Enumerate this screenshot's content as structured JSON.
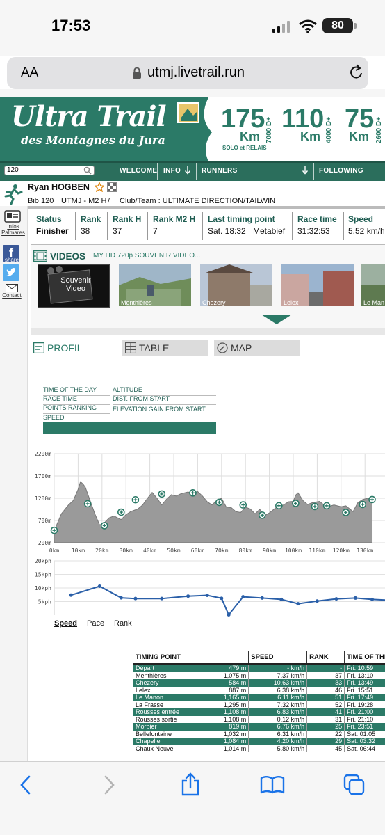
{
  "status_bar": {
    "time": "17:53",
    "battery": "80"
  },
  "browser": {
    "text_size": "AA",
    "url": "utmj.livetrail.run"
  },
  "banner": {
    "title": "Ultra Trail",
    "subtitle": "des Montagnes du Jura",
    "races": [
      {
        "km": "175",
        "unit": "Km",
        "elev": "7000 D+",
        "note": "SOLO et RELAIS"
      },
      {
        "km": "110",
        "unit": "Km",
        "elev": "4000 D+"
      },
      {
        "km": "75",
        "unit": "Km",
        "elev": "2600 D+"
      }
    ]
  },
  "nav": {
    "search_value": "120",
    "welcome": "WELCOME",
    "info": "INFO",
    "runners": "RUNNERS",
    "following": "FOLLOWING"
  },
  "runner": {
    "name": "Ryan HOGBEN",
    "bib": "Bib 120",
    "category": "UTMJ - M2 H",
    "sep": "/",
    "club": "Club/Team : ULTIMATE DIRECTION/TAILWIN"
  },
  "sidebar": {
    "infos": "Infos Palmares",
    "share": "share",
    "contact": "Contact"
  },
  "stats": {
    "headers": [
      "Status",
      "Rank",
      "Rank H",
      "Rank M2 H",
      "Last timing point",
      "Race time",
      "Speed"
    ],
    "values": [
      "Finisher",
      "38",
      "37",
      "7",
      "Sat. 18:32",
      "31:32:53",
      "5.52 km/h"
    ],
    "last_point_place": "Metabief"
  },
  "videos": {
    "title": "VIDEOS",
    "subtitle": "MY HD 720p SOUVENIR VIDEO...",
    "souvenir": "Souvenir Video",
    "items": [
      "Menthières",
      "Chezery",
      "Lelex",
      "Le Man"
    ]
  },
  "tabs": {
    "profil": "PROFIL",
    "table": "TABLE",
    "map": "MAP"
  },
  "legend": {
    "left": [
      "TIME OF THE DAY",
      "RACE TIME",
      "POINTS RANKING",
      "SPEED"
    ],
    "right": [
      "ALTITUDE",
      "DIST. FROM START",
      "ELEVATION GAIN FROM START"
    ]
  },
  "chart_data": [
    {
      "type": "area",
      "title": "",
      "ylim": [
        200,
        2200
      ],
      "y_ticks": [
        "2200m",
        "1700m",
        "1200m",
        "700m",
        "200m"
      ],
      "x_ticks": [
        "0km",
        "10km",
        "20km",
        "30km",
        "40km",
        "50km",
        "60km",
        "70km",
        "80km",
        "90km",
        "100km",
        "110km",
        "120km",
        "130km"
      ],
      "xlim": [
        0,
        133
      ],
      "profile": [
        [
          0,
          470
        ],
        [
          3,
          850
        ],
        [
          6,
          1050
        ],
        [
          8,
          1150
        ],
        [
          10,
          1400
        ],
        [
          11,
          1570
        ],
        [
          12,
          1520
        ],
        [
          13,
          1450
        ],
        [
          15,
          1150
        ],
        [
          17,
          850
        ],
        [
          19,
          600
        ],
        [
          21,
          650
        ],
        [
          23,
          760
        ],
        [
          25,
          800
        ],
        [
          28,
          720
        ],
        [
          30,
          830
        ],
        [
          32,
          900
        ],
        [
          35,
          960
        ],
        [
          37,
          1050
        ],
        [
          39,
          1200
        ],
        [
          41,
          1330
        ],
        [
          43,
          1200
        ],
        [
          45,
          1050
        ],
        [
          47,
          1180
        ],
        [
          49,
          1280
        ],
        [
          51,
          1250
        ],
        [
          53,
          1300
        ],
        [
          56,
          1340
        ],
        [
          58,
          1300
        ],
        [
          60,
          1350
        ],
        [
          62,
          1250
        ],
        [
          64,
          1120
        ],
        [
          66,
          1050
        ],
        [
          68,
          1150
        ],
        [
          70,
          1200
        ],
        [
          72,
          1000
        ],
        [
          74,
          990
        ],
        [
          76,
          900
        ],
        [
          78,
          880
        ],
        [
          80,
          1000
        ],
        [
          82,
          960
        ],
        [
          84,
          850
        ],
        [
          86,
          950
        ],
        [
          88,
          810
        ],
        [
          90,
          870
        ],
        [
          93,
          1000
        ],
        [
          96,
          1050
        ],
        [
          98,
          1120
        ],
        [
          100,
          1130
        ],
        [
          101,
          1270
        ],
        [
          102,
          1320
        ],
        [
          104,
          1150
        ],
        [
          106,
          1060
        ],
        [
          108,
          1100
        ],
        [
          111,
          1130
        ],
        [
          114,
          1000
        ],
        [
          117,
          1050
        ],
        [
          120,
          1010
        ],
        [
          122,
          1030
        ],
        [
          125,
          900
        ],
        [
          127,
          1100
        ],
        [
          129,
          1170
        ],
        [
          131,
          1200
        ],
        [
          133,
          1220
        ]
      ],
      "points": [
        [
          0,
          479
        ],
        [
          14,
          1075
        ],
        [
          21,
          584
        ],
        [
          28,
          887
        ],
        [
          34,
          1165
        ],
        [
          45,
          1295
        ],
        [
          58,
          1320
        ],
        [
          69,
          1108
        ],
        [
          79,
          1050
        ],
        [
          87,
          819
        ],
        [
          94,
          1032
        ],
        [
          101,
          1084
        ],
        [
          109,
          1014
        ],
        [
          114,
          1030
        ],
        [
          122,
          880
        ],
        [
          129,
          1060
        ],
        [
          133,
          1170
        ]
      ]
    },
    {
      "type": "line",
      "title": "",
      "ylim": [
        0,
        20
      ],
      "y_ticks": [
        "20kph",
        "15kph",
        "10kph",
        "5kph"
      ],
      "series": [
        {
          "values": [
            [
              7,
              7.37
            ],
            [
              19,
              10.63
            ],
            [
              28,
              6.38
            ],
            [
              34,
              6.11
            ],
            [
              45,
              6.11
            ],
            [
              56,
              7.0
            ],
            [
              64,
              7.3
            ],
            [
              70,
              6.2
            ],
            [
              73,
              0.12
            ],
            [
              79,
              6.76
            ],
            [
              87,
              6.31
            ],
            [
              95,
              5.8
            ],
            [
              102,
              4.2
            ],
            [
              110,
              5.2
            ],
            [
              118,
              6.0
            ],
            [
              126,
              6.3
            ],
            [
              133,
              5.8
            ],
            [
              140,
              5.52
            ]
          ]
        }
      ]
    }
  ],
  "modes": [
    "Speed",
    "Pace",
    "Rank"
  ],
  "timing_table": {
    "headers": [
      "TIMING POINT",
      "SPEED",
      "RANK",
      "TIME OF THE"
    ],
    "rows": [
      [
        "Départ",
        "479 m",
        "- km/h",
        "-",
        "Fri. 10:59"
      ],
      [
        "Menthières",
        "1,075 m",
        "7.37 km/h",
        "37",
        "Fri. 13:10"
      ],
      [
        "Chezery",
        "584 m",
        "10.63 km/h",
        "33",
        "Fri. 13:49"
      ],
      [
        "Lelex",
        "887 m",
        "6.38 km/h",
        "46",
        "Fri. 15:51"
      ],
      [
        "Le Manon",
        "1,165 m",
        "6.11 km/h",
        "51",
        "Fri. 17:49"
      ],
      [
        "La Frasse",
        "1,295 m",
        "7.32 km/h",
        "52",
        "Fri. 19:28"
      ],
      [
        "Rousses entrée",
        "1,108 m",
        "6.83 km/h",
        "41",
        "Fri. 21:00"
      ],
      [
        "Rousses sortie",
        "1,108 m",
        "0.12 km/h",
        "31",
        "Fri. 21:10"
      ],
      [
        "Morbier",
        "819 m",
        "6.76 km/h",
        "25",
        "Fri. 23:51"
      ],
      [
        "Bellefontaine",
        "1,032 m",
        "6.31 km/h",
        "22",
        "Sat. 01:05"
      ],
      [
        "Chapelle",
        "1,084 m",
        "4.20 km/h",
        "29",
        "Sat. 03:32"
      ],
      [
        "Chaux Neuve",
        "1,014 m",
        "5.80 km/h",
        "45",
        "Sat. 06:44"
      ]
    ]
  },
  "colors": {
    "brand": "#2b7a67",
    "nav": "#2b6e5c",
    "header_text": "#1f5d52"
  },
  "icons": [
    "signal-icon",
    "wifi-icon",
    "lock-icon",
    "reload-icon",
    "search-icon",
    "star-icon",
    "back-icon",
    "forward-icon",
    "share-icon",
    "bookmarks-icon",
    "tabs-icon"
  ]
}
